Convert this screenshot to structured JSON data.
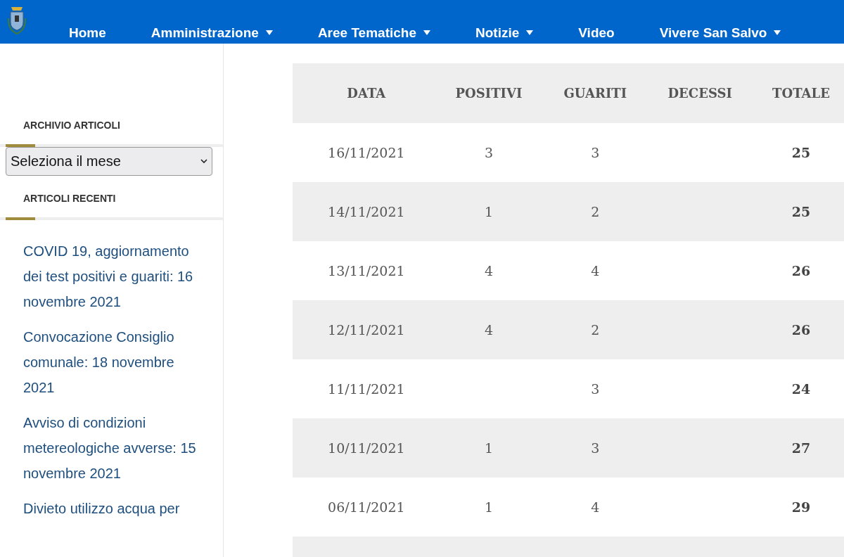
{
  "nav": {
    "items": [
      {
        "label": "Home",
        "dropdown": false
      },
      {
        "label": "Amministrazione",
        "dropdown": true
      },
      {
        "label": "Aree Tematiche",
        "dropdown": true
      },
      {
        "label": "Notizie",
        "dropdown": true
      },
      {
        "label": "Video",
        "dropdown": false
      },
      {
        "label": "Vivere San Salvo",
        "dropdown": true
      }
    ]
  },
  "sidebar": {
    "archive_heading": "ARCHIVIO ARTICOLI",
    "month_select": {
      "value": "Seleziona il mese"
    },
    "recent_heading": "ARTICOLI RECENTI",
    "recent_articles": [
      "COVID 19, aggiornamento dei test positivi e guariti: 16 novembre 2021",
      "Convocazione Consiglio comunale: 18 novembre 2021",
      "Avviso di condizioni metereologiche avverse: 15 novembre 2021",
      "Divieto utilizzo acqua per"
    ]
  },
  "table": {
    "columns": [
      "DATA",
      "POSITIVI",
      "GUARITI",
      "DECESSI",
      "TOTALE"
    ],
    "rows": [
      {
        "data": "16/11/2021",
        "positivi": "3",
        "guariti": "3",
        "totale": "25"
      },
      {
        "data": "14/11/2021",
        "positivi": "1",
        "guariti": "2",
        "totale": "25"
      },
      {
        "data": "13/11/2021",
        "positivi": "4",
        "guariti": "4",
        "totale": "26"
      },
      {
        "data": "12/11/2021",
        "positivi": "4",
        "guariti": "2",
        "totale": "26"
      },
      {
        "data": "11/11/2021",
        "guariti": "3",
        "totale": "24"
      },
      {
        "data": "10/11/2021",
        "positivi": "1",
        "guariti": "3",
        "totale": "27"
      },
      {
        "data": "06/11/2021",
        "positivi": "1",
        "guariti": "4",
        "totale": "29"
      }
    ]
  }
}
